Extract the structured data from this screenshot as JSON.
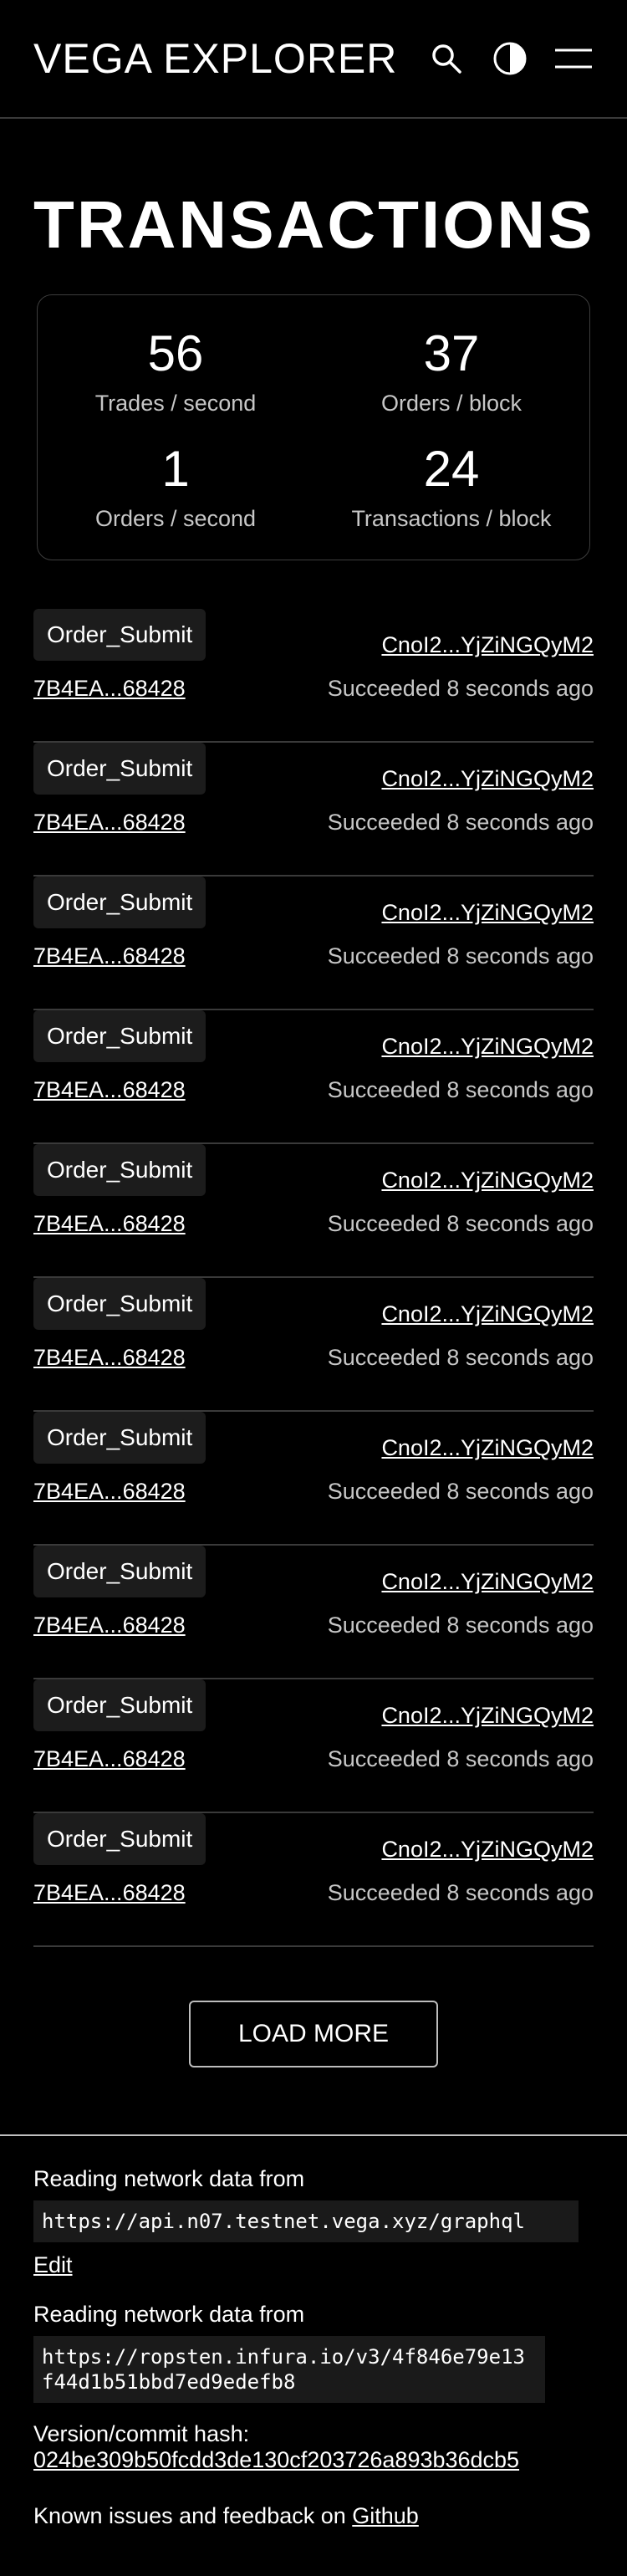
{
  "header": {
    "brand": "VEGA EXPLORER"
  },
  "page": {
    "title": "TRANSACTIONS"
  },
  "stats": [
    {
      "value": "56",
      "label": "Trades / second"
    },
    {
      "value": "37",
      "label": "Orders / block"
    },
    {
      "value": "1",
      "label": "Orders / second"
    },
    {
      "value": "24",
      "label": "Transactions / block"
    }
  ],
  "transactions": [
    {
      "type": "Order_Submit",
      "submitter": "CnoI2...YjZiNGQyM2",
      "hash": "7B4EA...68428",
      "status": "Succeeded 8 seconds ago"
    },
    {
      "type": "Order_Submit",
      "submitter": "CnoI2...YjZiNGQyM2",
      "hash": "7B4EA...68428",
      "status": "Succeeded 8 seconds ago"
    },
    {
      "type": "Order_Submit",
      "submitter": "CnoI2...YjZiNGQyM2",
      "hash": "7B4EA...68428",
      "status": "Succeeded 8 seconds ago"
    },
    {
      "type": "Order_Submit",
      "submitter": "CnoI2...YjZiNGQyM2",
      "hash": "7B4EA...68428",
      "status": "Succeeded 8 seconds ago"
    },
    {
      "type": "Order_Submit",
      "submitter": "CnoI2...YjZiNGQyM2",
      "hash": "7B4EA...68428",
      "status": "Succeeded 8 seconds ago"
    },
    {
      "type": "Order_Submit",
      "submitter": "CnoI2...YjZiNGQyM2",
      "hash": "7B4EA...68428",
      "status": "Succeeded 8 seconds ago"
    },
    {
      "type": "Order_Submit",
      "submitter": "CnoI2...YjZiNGQyM2",
      "hash": "7B4EA...68428",
      "status": "Succeeded 8 seconds ago"
    },
    {
      "type": "Order_Submit",
      "submitter": "CnoI2...YjZiNGQyM2",
      "hash": "7B4EA...68428",
      "status": "Succeeded 8 seconds ago"
    },
    {
      "type": "Order_Submit",
      "submitter": "CnoI2...YjZiNGQyM2",
      "hash": "7B4EA...68428",
      "status": "Succeeded 8 seconds ago"
    },
    {
      "type": "Order_Submit",
      "submitter": "CnoI2...YjZiNGQyM2",
      "hash": "7B4EA...68428",
      "status": "Succeeded 8 seconds ago"
    }
  ],
  "load_more": {
    "label": "LOAD MORE"
  },
  "footer": {
    "network_label_1": "Reading network data from",
    "network_url_1": "https://api.n07.testnet.vega.xyz/graphql",
    "edit_label": "Edit",
    "network_label_2": "Reading network data from",
    "network_url_2": "https://ropsten.infura.io/v3/4f846e79e13f44d1b51bbd7ed9edefb8",
    "version_label": "Version/commit hash:",
    "version_hash": "024be309b50fcdd3de130cf203726a893b36dcb5",
    "known_issues_text": "Known issues and feedback on ",
    "github_label": "Github"
  },
  "icons": {
    "search": "search-icon",
    "theme": "theme-toggle-icon",
    "menu": "menu-icon"
  }
}
